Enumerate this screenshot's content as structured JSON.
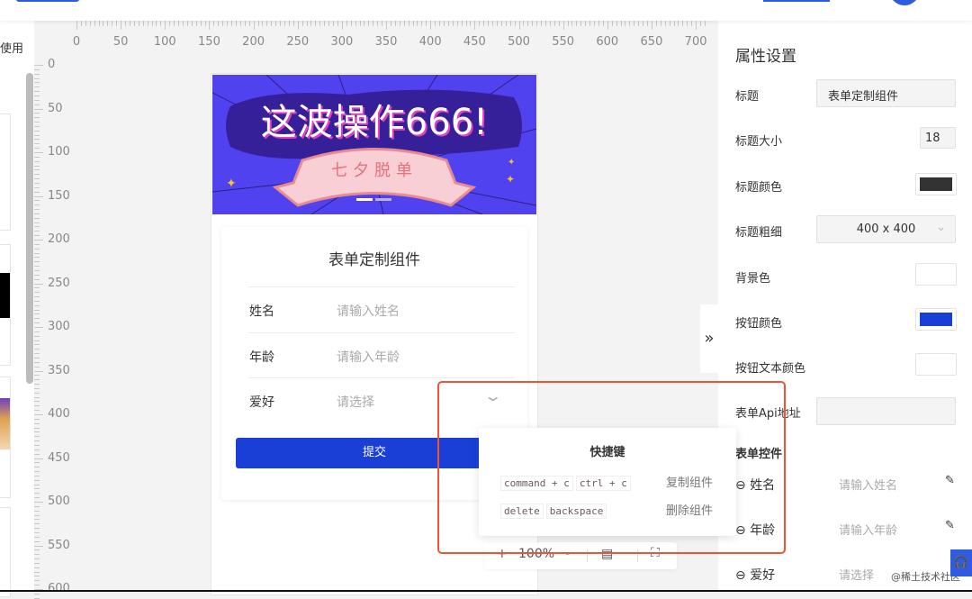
{
  "left_panel": {
    "label_fragment": "使用"
  },
  "rulers": {
    "horizontal": [
      0,
      50,
      100,
      150,
      200,
      250,
      300,
      350,
      400,
      450,
      500,
      550,
      600,
      650,
      700
    ],
    "vertical": [
      0,
      50,
      100,
      150,
      200,
      250,
      300,
      350,
      400,
      450,
      500,
      550,
      600
    ]
  },
  "banner": {
    "headline": "这波操作666!",
    "ribbon": "七夕脱单",
    "slides": 2,
    "active_slide": 1
  },
  "form": {
    "title": "表单定制组件",
    "fields": [
      {
        "label": "姓名",
        "placeholder": "请输入姓名"
      },
      {
        "label": "年龄",
        "placeholder": "请输入年龄"
      },
      {
        "label": "爱好",
        "placeholder": "请选择"
      }
    ],
    "submit": "提交"
  },
  "shortcuts": {
    "title": "快捷键",
    "rows": [
      {
        "keys": [
          "command + c",
          "ctrl + c"
        ],
        "action": "复制组件"
      },
      {
        "keys": [
          "delete",
          "backspace"
        ],
        "action": "删除组件"
      }
    ]
  },
  "zoombar": {
    "plus": "+",
    "zoom": "100%",
    "minus": "-"
  },
  "props": {
    "heading": "属性设置",
    "title_label": "标题",
    "title_value": "表单定制组件",
    "size_label": "标题大小",
    "size_value": "18",
    "color_label": "标题颜色",
    "color_value": "#333333",
    "weight_label": "标题粗细",
    "weight_value": "400 x 400",
    "bg_label": "背景色",
    "bg_value": "#ffffff",
    "btn_color_label": "按钮颜色",
    "btn_color_value": "#1a3fd6",
    "btn_text_label": "按钮文本颜色",
    "btn_text_value": "#ffffff",
    "api_label": "表单Api地址",
    "api_value": "",
    "controls_heading": "表单控件",
    "controls": [
      {
        "label": "姓名",
        "placeholder": "请输入姓名"
      },
      {
        "label": "年龄",
        "placeholder": "请输入年龄"
      },
      {
        "label": "爱好",
        "placeholder": "请选择"
      }
    ]
  },
  "collapse": "»",
  "watermark": "@稀土技术社区"
}
